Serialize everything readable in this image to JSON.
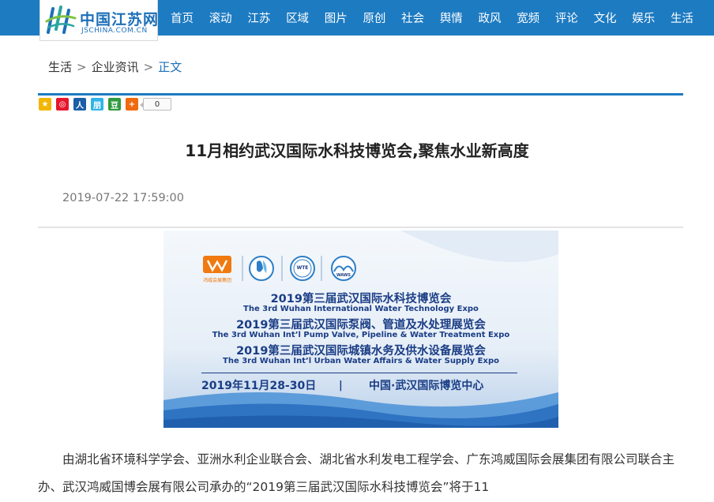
{
  "site": {
    "logo_text": "中国江苏网",
    "logo_sub": "JSCHINA.COM.CN",
    "brand_color": "#1d7bc2"
  },
  "nav": {
    "items": [
      "首页",
      "滚动",
      "江苏",
      "区域",
      "图片",
      "原创",
      "社会",
      "舆情",
      "政风",
      "宽频",
      "评论",
      "文化",
      "娱乐",
      "生活"
    ]
  },
  "breadcrumb": {
    "items": [
      "生活",
      "企业资讯",
      "正文"
    ],
    "separator": ">"
  },
  "share": {
    "icons": [
      "qzone-icon",
      "weibo-icon",
      "renren-icon",
      "pengyou-icon",
      "douban-icon",
      "more-icon"
    ],
    "glyphs": [
      "★",
      "◎",
      "人",
      "朋",
      "豆",
      "+"
    ],
    "colors": [
      "#f2b600",
      "#e6162d",
      "#1a5ea8",
      "#2fb3e8",
      "#2f9a3f",
      "#f06a0f"
    ],
    "count": "0"
  },
  "article": {
    "title": "11月相约武汉国际水科技博览会,聚焦水业新高度",
    "date": "2019-07-22 17:59:00",
    "body": "由湖北省环境科学学会、亚洲水利企业联合会、湖北省水利发电工程学会、广东鸿威国际会展集团有限公司联合主办、武汉鸿威国博会展有限公司承办的“2019第三届武汉国际水科技博览会”将于11"
  },
  "banner": {
    "logo_caption": "鸿威会展集团",
    "logo_badge_wte": "WTE",
    "logo_badge_wawe": "WAWS",
    "lines": [
      {
        "cn": "2019第三届武汉国际水科技博览会",
        "en": "The 3rd Wuhan International Water Technology Expo"
      },
      {
        "cn": "2019第三届武汉国际泵阀、管道及水处理展览会",
        "en": "The 3rd Wuhan Int’l Pump Valve, Pipeline & Water Treatment Expo"
      },
      {
        "cn": "2019第三届武汉国际城镇水务及供水设备展览会",
        "en": "The 3rd Wuhan Int’l Urban Water Affairs & Water Supply Expo"
      }
    ],
    "date": "2019年11月28-30日",
    "separator": "|",
    "venue": "中国·武汉国际博览中心"
  }
}
